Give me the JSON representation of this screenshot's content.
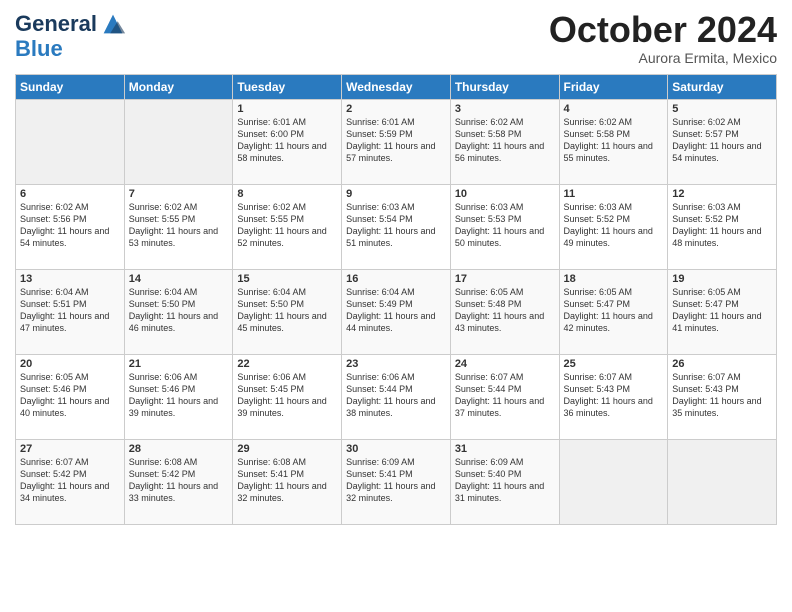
{
  "header": {
    "logo_general": "General",
    "logo_blue": "Blue",
    "month": "October 2024",
    "location": "Aurora Ermita, Mexico"
  },
  "weekdays": [
    "Sunday",
    "Monday",
    "Tuesday",
    "Wednesday",
    "Thursday",
    "Friday",
    "Saturday"
  ],
  "weeks": [
    [
      {
        "day": "",
        "text": ""
      },
      {
        "day": "",
        "text": ""
      },
      {
        "day": "1",
        "text": "Sunrise: 6:01 AM\nSunset: 6:00 PM\nDaylight: 11 hours and 58 minutes."
      },
      {
        "day": "2",
        "text": "Sunrise: 6:01 AM\nSunset: 5:59 PM\nDaylight: 11 hours and 57 minutes."
      },
      {
        "day": "3",
        "text": "Sunrise: 6:02 AM\nSunset: 5:58 PM\nDaylight: 11 hours and 56 minutes."
      },
      {
        "day": "4",
        "text": "Sunrise: 6:02 AM\nSunset: 5:58 PM\nDaylight: 11 hours and 55 minutes."
      },
      {
        "day": "5",
        "text": "Sunrise: 6:02 AM\nSunset: 5:57 PM\nDaylight: 11 hours and 54 minutes."
      }
    ],
    [
      {
        "day": "6",
        "text": "Sunrise: 6:02 AM\nSunset: 5:56 PM\nDaylight: 11 hours and 54 minutes."
      },
      {
        "day": "7",
        "text": "Sunrise: 6:02 AM\nSunset: 5:55 PM\nDaylight: 11 hours and 53 minutes."
      },
      {
        "day": "8",
        "text": "Sunrise: 6:02 AM\nSunset: 5:55 PM\nDaylight: 11 hours and 52 minutes."
      },
      {
        "day": "9",
        "text": "Sunrise: 6:03 AM\nSunset: 5:54 PM\nDaylight: 11 hours and 51 minutes."
      },
      {
        "day": "10",
        "text": "Sunrise: 6:03 AM\nSunset: 5:53 PM\nDaylight: 11 hours and 50 minutes."
      },
      {
        "day": "11",
        "text": "Sunrise: 6:03 AM\nSunset: 5:52 PM\nDaylight: 11 hours and 49 minutes."
      },
      {
        "day": "12",
        "text": "Sunrise: 6:03 AM\nSunset: 5:52 PM\nDaylight: 11 hours and 48 minutes."
      }
    ],
    [
      {
        "day": "13",
        "text": "Sunrise: 6:04 AM\nSunset: 5:51 PM\nDaylight: 11 hours and 47 minutes."
      },
      {
        "day": "14",
        "text": "Sunrise: 6:04 AM\nSunset: 5:50 PM\nDaylight: 11 hours and 46 minutes."
      },
      {
        "day": "15",
        "text": "Sunrise: 6:04 AM\nSunset: 5:50 PM\nDaylight: 11 hours and 45 minutes."
      },
      {
        "day": "16",
        "text": "Sunrise: 6:04 AM\nSunset: 5:49 PM\nDaylight: 11 hours and 44 minutes."
      },
      {
        "day": "17",
        "text": "Sunrise: 6:05 AM\nSunset: 5:48 PM\nDaylight: 11 hours and 43 minutes."
      },
      {
        "day": "18",
        "text": "Sunrise: 6:05 AM\nSunset: 5:47 PM\nDaylight: 11 hours and 42 minutes."
      },
      {
        "day": "19",
        "text": "Sunrise: 6:05 AM\nSunset: 5:47 PM\nDaylight: 11 hours and 41 minutes."
      }
    ],
    [
      {
        "day": "20",
        "text": "Sunrise: 6:05 AM\nSunset: 5:46 PM\nDaylight: 11 hours and 40 minutes."
      },
      {
        "day": "21",
        "text": "Sunrise: 6:06 AM\nSunset: 5:46 PM\nDaylight: 11 hours and 39 minutes."
      },
      {
        "day": "22",
        "text": "Sunrise: 6:06 AM\nSunset: 5:45 PM\nDaylight: 11 hours and 39 minutes."
      },
      {
        "day": "23",
        "text": "Sunrise: 6:06 AM\nSunset: 5:44 PM\nDaylight: 11 hours and 38 minutes."
      },
      {
        "day": "24",
        "text": "Sunrise: 6:07 AM\nSunset: 5:44 PM\nDaylight: 11 hours and 37 minutes."
      },
      {
        "day": "25",
        "text": "Sunrise: 6:07 AM\nSunset: 5:43 PM\nDaylight: 11 hours and 36 minutes."
      },
      {
        "day": "26",
        "text": "Sunrise: 6:07 AM\nSunset: 5:43 PM\nDaylight: 11 hours and 35 minutes."
      }
    ],
    [
      {
        "day": "27",
        "text": "Sunrise: 6:07 AM\nSunset: 5:42 PM\nDaylight: 11 hours and 34 minutes."
      },
      {
        "day": "28",
        "text": "Sunrise: 6:08 AM\nSunset: 5:42 PM\nDaylight: 11 hours and 33 minutes."
      },
      {
        "day": "29",
        "text": "Sunrise: 6:08 AM\nSunset: 5:41 PM\nDaylight: 11 hours and 32 minutes."
      },
      {
        "day": "30",
        "text": "Sunrise: 6:09 AM\nSunset: 5:41 PM\nDaylight: 11 hours and 32 minutes."
      },
      {
        "day": "31",
        "text": "Sunrise: 6:09 AM\nSunset: 5:40 PM\nDaylight: 11 hours and 31 minutes."
      },
      {
        "day": "",
        "text": ""
      },
      {
        "day": "",
        "text": ""
      }
    ]
  ]
}
